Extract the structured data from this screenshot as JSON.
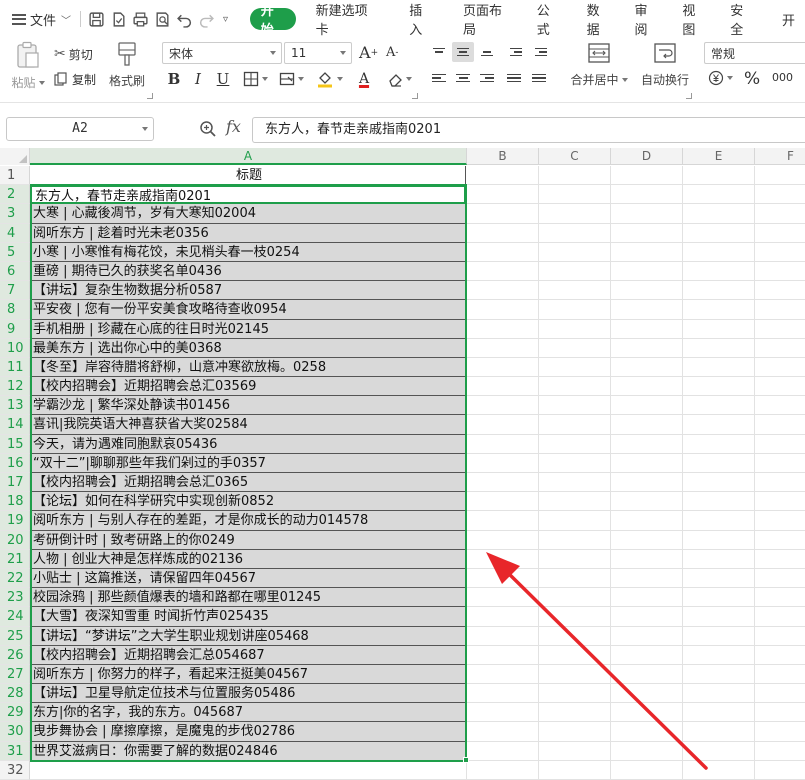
{
  "menubar": {
    "file_label": "文件",
    "tabs": [
      "开始",
      "新建选项卡",
      "插入",
      "页面布局",
      "公式",
      "数据",
      "审阅",
      "视图",
      "安全",
      "开"
    ]
  },
  "ribbon": {
    "paste_label": "粘贴",
    "cut_label": "剪切",
    "copy_label": "复制",
    "format_painter_label": "格式刷",
    "font_name": "宋体",
    "font_size": "11",
    "bold": "B",
    "italic": "I",
    "underline": "U",
    "merge_label": "合并居中",
    "wrap_label": "自动换行",
    "number_format": "常规",
    "percent": "%",
    "thousands": "000"
  },
  "formula_bar": {
    "name_box": "A2",
    "fx": "fx",
    "content": "东方人，春节走亲戚指南0201"
  },
  "grid": {
    "columns": [
      "A",
      "B",
      "C",
      "D",
      "E",
      "F"
    ],
    "rows": [
      {
        "num": "1",
        "a": "标题"
      },
      {
        "num": "2",
        "a": "东方人，春节走亲戚指南0201"
      },
      {
        "num": "3",
        "a": "大寒 | 心藏後凋节，岁有大寒知02004"
      },
      {
        "num": "4",
        "a": "阅听东方 | 趁着时光未老0356"
      },
      {
        "num": "5",
        "a": "小寒 | 小寒惟有梅花饺，未见梢头春一枝0254"
      },
      {
        "num": "6",
        "a": "重磅 | 期待已久的获奖名单0436"
      },
      {
        "num": "7",
        "a": "【讲坛】复杂生物数据分析0587"
      },
      {
        "num": "8",
        "a": "平安夜 | 您有一份平安美食攻略待查收0954"
      },
      {
        "num": "9",
        "a": "手机相册 | 珍藏在心底的往日时光02145"
      },
      {
        "num": "10",
        "a": "最美东方 | 选出你心中的美0368"
      },
      {
        "num": "11",
        "a": "【冬至】岸容待腊将舒柳，山意冲寒欲放梅。0258"
      },
      {
        "num": "12",
        "a": "【校内招聘会】近期招聘会总汇03569"
      },
      {
        "num": "13",
        "a": "学霸沙龙 | 繁华深处静读书01456"
      },
      {
        "num": "14",
        "a": "喜讯|我院英语大神喜获省大奖02584"
      },
      {
        "num": "15",
        "a": "今天，请为遇难同胞默哀05436"
      },
      {
        "num": "16",
        "a": "“双十二”|聊聊那些年我们剁过的手0357"
      },
      {
        "num": "17",
        "a": "【校内招聘会】近期招聘会总汇0365"
      },
      {
        "num": "18",
        "a": "【论坛】如何在科学研究中实现创新0852"
      },
      {
        "num": "19",
        "a": "阅听东方 | 与别人存在的差距，才是你成长的动力014578"
      },
      {
        "num": "20",
        "a": "考研倒计时 | 致考研路上的你0249"
      },
      {
        "num": "21",
        "a": "人物 | 创业大神是怎样炼成的02136"
      },
      {
        "num": "22",
        "a": "小贴士 | 这篇推送，请保留四年04567"
      },
      {
        "num": "23",
        "a": "校园涂鸦 | 那些颜值爆表的墙和路都在哪里01245"
      },
      {
        "num": "24",
        "a": "【大雪】夜深知雪重 时闻折竹声025435"
      },
      {
        "num": "25",
        "a": "【讲坛】“梦讲坛”之大学生职业规划讲座05468"
      },
      {
        "num": "26",
        "a": "【校内招聘会】近期招聘会汇总054687"
      },
      {
        "num": "27",
        "a": "阅听东方 | 你努力的样子，看起来汪挺美04567"
      },
      {
        "num": "28",
        "a": "【讲坛】卫星导航定位技术与位置服务05486"
      },
      {
        "num": "29",
        "a": "东方|你的名字，我的东方。045687"
      },
      {
        "num": "30",
        "a": "曳步舞协会 | 摩擦摩擦，是魔鬼的步伐02786"
      },
      {
        "num": "31",
        "a": "世界艾滋病日：你需要了解的数据024846"
      },
      {
        "num": "32",
        "a": ""
      }
    ]
  },
  "colors": {
    "accent": "#1e9e4a",
    "selection_fill": "#d9d9d9",
    "arrow": "#e8262a"
  }
}
